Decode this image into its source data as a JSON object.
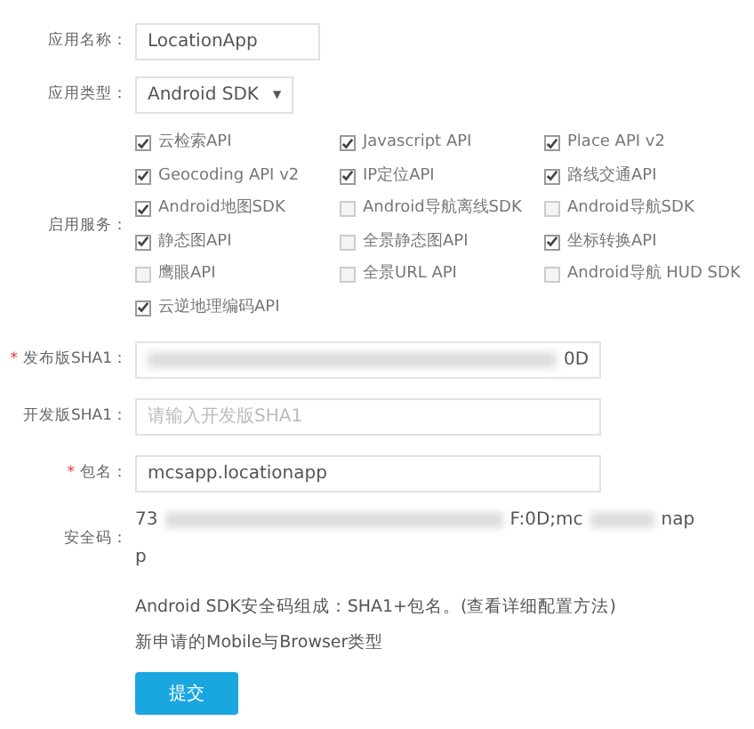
{
  "fields": [
    {
      "kind": "text",
      "label": "应用名称：",
      "value": "LocationApp"
    },
    {
      "kind": "select",
      "label": "应用类型：",
      "value": "Android SDK",
      "caret": "▼"
    }
  ],
  "services": {
    "label": "启用服务：",
    "items": [
      {
        "label": "云检索API",
        "checked": true
      },
      {
        "label": "Javascript API",
        "checked": true
      },
      {
        "label": "Place API v2",
        "checked": true
      },
      {
        "label": "Geocoding API v2",
        "checked": true
      },
      {
        "label": "IP定位API",
        "checked": true
      },
      {
        "label": "路线交通API",
        "checked": true
      },
      {
        "label": "Android地图SDK",
        "checked": true
      },
      {
        "label": "Android导航离线SDK",
        "checked": false
      },
      {
        "label": "Android导航SDK",
        "checked": false
      },
      {
        "label": "静态图API",
        "checked": true
      },
      {
        "label": "全景静态图API",
        "checked": false
      },
      {
        "label": "坐标转换API",
        "checked": true
      },
      {
        "label": "鹰眼API",
        "checked": false
      },
      {
        "label": "全景URL API",
        "checked": false
      },
      {
        "label": "Android导航 HUD SDK",
        "checked": false
      },
      {
        "label": "云逆地理编码API",
        "checked": true
      }
    ]
  },
  "sha_fields": [
    {
      "label": "发布版SHA1：",
      "required_mark": "*",
      "value": "0D",
      "redacted": true
    },
    {
      "label": "开发版SHA1：",
      "placeholder": "请输入开发版SHA1"
    },
    {
      "label": "包名：",
      "required_mark": "*",
      "value": "mcsapp.locationapp"
    }
  ],
  "security_code": {
    "label": "安全码：",
    "parts": [
      "73",
      "F:0D;mc",
      "nap"
    ],
    "continuation": "p"
  },
  "notes": [
    "Android SDK安全码组成：SHA1+包名。(查看详细配置方法)",
    "新申请的Mobile与Browser类型"
  ],
  "submit": "提交"
}
